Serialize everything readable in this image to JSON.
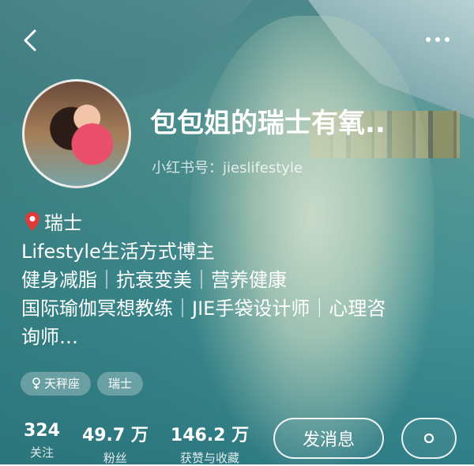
{
  "profile": {
    "name": "包包姐的瑞士有氧..",
    "handle": "小红书号：jieslifestyle",
    "location": "瑞士",
    "bio_lines": [
      "Lifestyle生活方式博主",
      "健身减脂｜抗衰变美｜营养健康",
      "国际瑜伽冥想教练｜JIE手袋设计师｜心理咨",
      "询师…"
    ],
    "tags": [
      "天秤座",
      "瑞士"
    ]
  },
  "stats": [
    {
      "value": "324",
      "label": "关注"
    },
    {
      "value": "49.7 万",
      "label": "粉丝"
    },
    {
      "value": "146.2 万",
      "label": "获赞与收藏"
    }
  ],
  "actions": {
    "message_label": "发消息"
  },
  "icons": {
    "back": "back-chevron-icon",
    "more": "more-dots-icon",
    "location": "location-pin-icon",
    "gender": "female-icon",
    "settings": "settings-gear-icon"
  },
  "colors": {
    "background_teal": "#2f7d86",
    "pin_red": "#e03a3a",
    "text": "#ffffff"
  }
}
